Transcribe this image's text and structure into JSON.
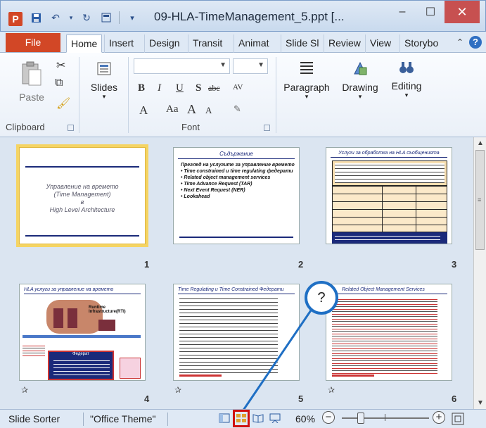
{
  "window": {
    "title": "09-HLA-TimeManagement_5.ppt [...",
    "app_icon": "P",
    "minimize": "–",
    "maximize": "☐",
    "close": "✕"
  },
  "tabs": {
    "file": "File",
    "items": [
      "Home",
      "Insert",
      "Design",
      "Transit",
      "Animat",
      "Slide Sl",
      "Review",
      "View",
      "Storybo"
    ],
    "active": "Home"
  },
  "ribbon": {
    "clipboard": {
      "label": "Clipboard",
      "paste": "Paste"
    },
    "slides": {
      "label": "Slides"
    },
    "font": {
      "label": "Font",
      "bold": "B",
      "italic": "I",
      "underline": "U",
      "shadow": "S",
      "strike": "abc",
      "spacing": "AV",
      "grow": "A",
      "shrink": "A",
      "case": "Aa"
    },
    "paragraph": {
      "label": "Paragraph"
    },
    "drawing": {
      "label": "Drawing"
    },
    "editing": {
      "label": "Editing"
    }
  },
  "slides": [
    {
      "number": "1",
      "title_line1": "Управление на времето",
      "title_line2": "(Time Management)",
      "title_line3": "в",
      "title_line4": "High Level Architecture"
    },
    {
      "number": "2",
      "heading": "Съдържание",
      "body": [
        "Преглед на услугите за управление времето",
        "• Time constrained и time regulating федерати",
        "• Related object management services",
        "• Time Advance Request (TAR)",
        "• Next Event Request (NER)",
        "• Lookahead"
      ]
    },
    {
      "number": "3",
      "heading": "Услуги за обработка на HLA съобщенията"
    },
    {
      "number": "4",
      "heading": "HLA услуги за управление на времето",
      "rti_label": "Runtime Infrastructure(RTI)",
      "federate_label": "Федерат"
    },
    {
      "number": "5",
      "heading": "Time Regulating и Time Constrained Федерати"
    },
    {
      "number": "6",
      "heading": "Related Object Management Services"
    }
  ],
  "statusbar": {
    "view_label": "Slide Sorter",
    "theme": "\"Office Theme\"",
    "zoom": "60%",
    "zoom_out": "−",
    "zoom_in": "+"
  },
  "callout": {
    "text": "?"
  },
  "colors": {
    "file_tab": "#d24726",
    "accent": "#1f6fc4",
    "highlight": "#d01010",
    "selected_slide": "#f5d463"
  }
}
